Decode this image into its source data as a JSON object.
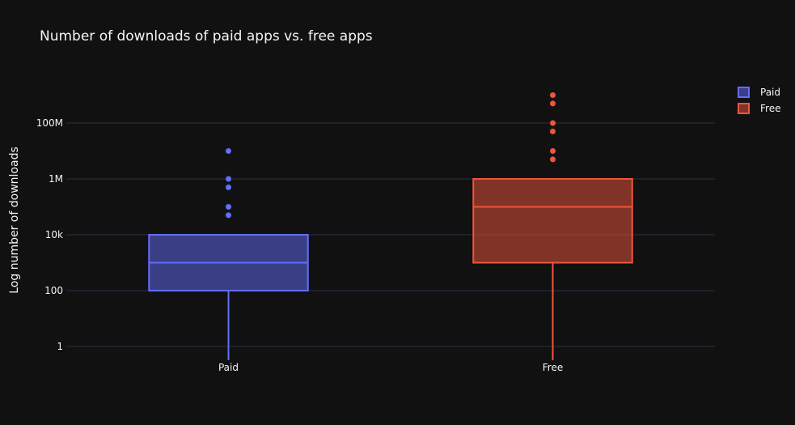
{
  "chart_data": {
    "type": "box",
    "title": "Number of downloads of paid apps vs. free apps",
    "ylabel": "Log number of downloads",
    "xlabel": "",
    "yscale": "log",
    "ylim": [
      0.3,
      2000000000
    ],
    "yticks": [
      {
        "value": 1,
        "label": "1"
      },
      {
        "value": 100,
        "label": "100"
      },
      {
        "value": 10000,
        "label": "10k"
      },
      {
        "value": 1000000,
        "label": "1M"
      },
      {
        "value": 100000000,
        "label": "100M"
      }
    ],
    "grid": true,
    "legend_position": "top-right",
    "categories": [
      "Paid",
      "Free"
    ],
    "series": [
      {
        "name": "Paid",
        "color": "#636efa",
        "min": 0.3,
        "q1": 100,
        "median": 1000,
        "q3": 10000,
        "max": 10000,
        "outliers": [
          50000,
          100000,
          500000,
          1000000,
          10000000
        ]
      },
      {
        "name": "Free",
        "color": "#ef553b",
        "min": 0.3,
        "q1": 1000,
        "median": 100000,
        "q3": 1000000,
        "max": 1000000,
        "outliers": [
          5000000,
          10000000,
          50000000,
          100000000,
          500000000,
          1000000000
        ]
      }
    ]
  }
}
